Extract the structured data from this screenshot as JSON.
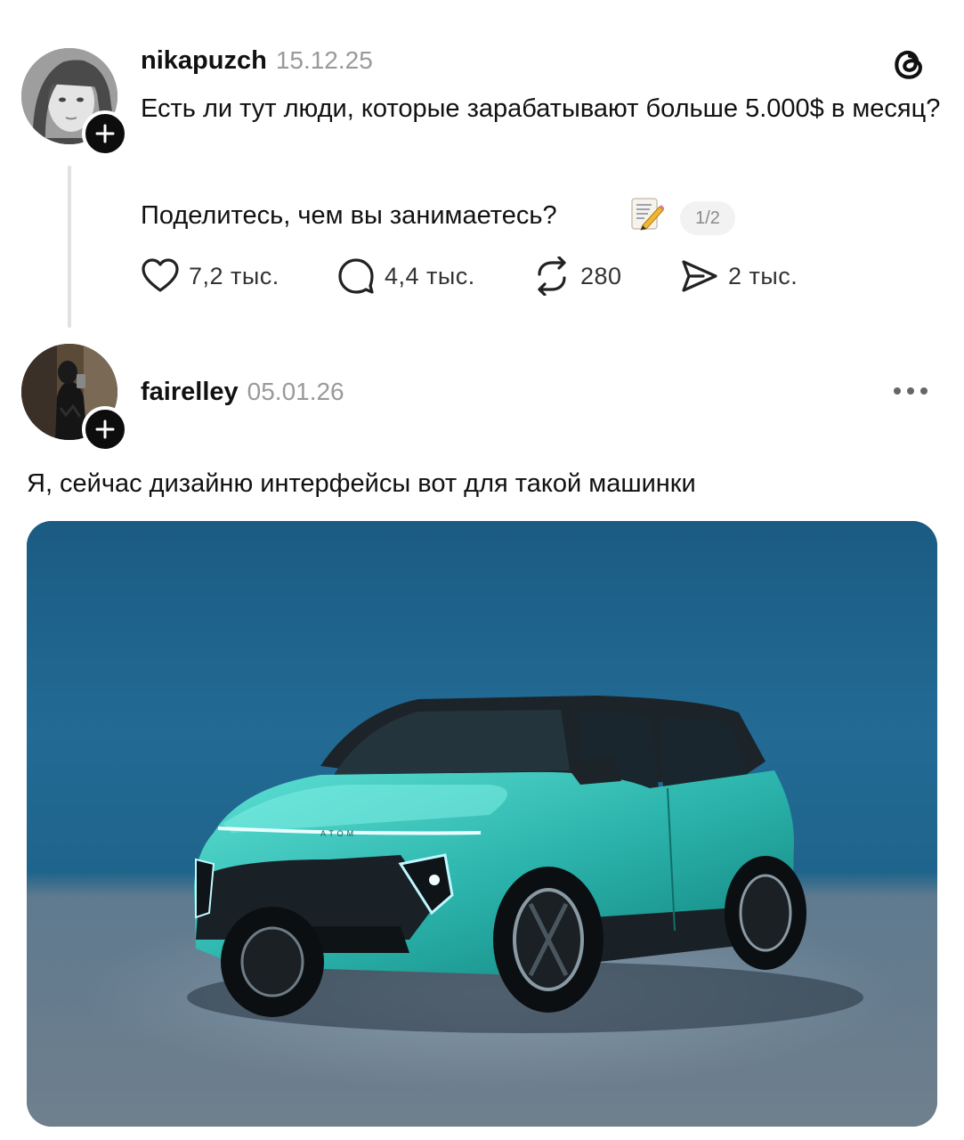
{
  "post1": {
    "username": "nikapuzch",
    "date": "15.12.25",
    "text_line1": "Есть ли тут люди, которые зарабатывают больше 5.000$ в месяц?",
    "text_line2": "Поделитесь, чем вы занимаетесь?",
    "emoji": "📝",
    "page_indicator": "1/2",
    "likes": "7,2 тыс.",
    "replies": "4,4 тыс.",
    "reposts": "280",
    "shares": "2 тыс."
  },
  "post2": {
    "username": "fairelley",
    "date": "05.01.26",
    "text": "Я, сейчас дизайню интерфейсы вот для такой машинки",
    "car_badge": "ATOM"
  },
  "colors": {
    "text": "#111111",
    "muted": "#9a9a9a",
    "car_teal": "#2fb8b0",
    "backdrop_blue": "#1f6a93"
  },
  "icons": {
    "brand": "threads-logo-icon",
    "follow": "plus-icon",
    "like": "heart-icon",
    "reply": "comment-icon",
    "repost": "repost-icon",
    "share": "send-icon",
    "menu": "more-icon"
  }
}
